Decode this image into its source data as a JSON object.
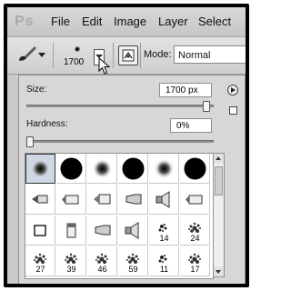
{
  "menu": {
    "logo": "Ps",
    "items": [
      "File",
      "Edit",
      "Image",
      "Layer",
      "Select"
    ]
  },
  "options": {
    "brush_size": "1700",
    "mode_label": "Mode:",
    "mode_value": "Normal"
  },
  "panel": {
    "size_label": "Size:",
    "size_value": "1700 px",
    "hardness_label": "Hardness:",
    "hardness_value": "0%",
    "size_slider_level": 0.98,
    "hardness_slider_level": 0.0
  },
  "brush_tips": [
    {
      "kind": "soft",
      "label": ""
    },
    {
      "kind": "hard",
      "label": ""
    },
    {
      "kind": "soft",
      "label": ""
    },
    {
      "kind": "hard",
      "label": ""
    },
    {
      "kind": "soft",
      "label": ""
    },
    {
      "kind": "hard",
      "label": ""
    },
    {
      "kind": "tool-pencil",
      "label": ""
    },
    {
      "kind": "tool-marker",
      "label": ""
    },
    {
      "kind": "tool-pen",
      "label": ""
    },
    {
      "kind": "tool-chisel",
      "label": ""
    },
    {
      "kind": "tool-speaker",
      "label": ""
    },
    {
      "kind": "tool-marker",
      "label": ""
    },
    {
      "kind": "tool-square",
      "label": ""
    },
    {
      "kind": "tool-tube",
      "label": ""
    },
    {
      "kind": "tool-chisel",
      "label": ""
    },
    {
      "kind": "tool-speaker",
      "label": ""
    },
    {
      "kind": "splat-small",
      "label": "14"
    },
    {
      "kind": "splat",
      "label": "24"
    },
    {
      "kind": "splat",
      "label": "27"
    },
    {
      "kind": "splat",
      "label": "39"
    },
    {
      "kind": "splat",
      "label": "46"
    },
    {
      "kind": "splat",
      "label": "59"
    },
    {
      "kind": "splat-small",
      "label": "11"
    },
    {
      "kind": "splat",
      "label": "17"
    }
  ],
  "colors": {
    "menubar": "#cfcfcf",
    "panel": "#d7d7d7",
    "selected_cell": "#cfd7e6"
  }
}
